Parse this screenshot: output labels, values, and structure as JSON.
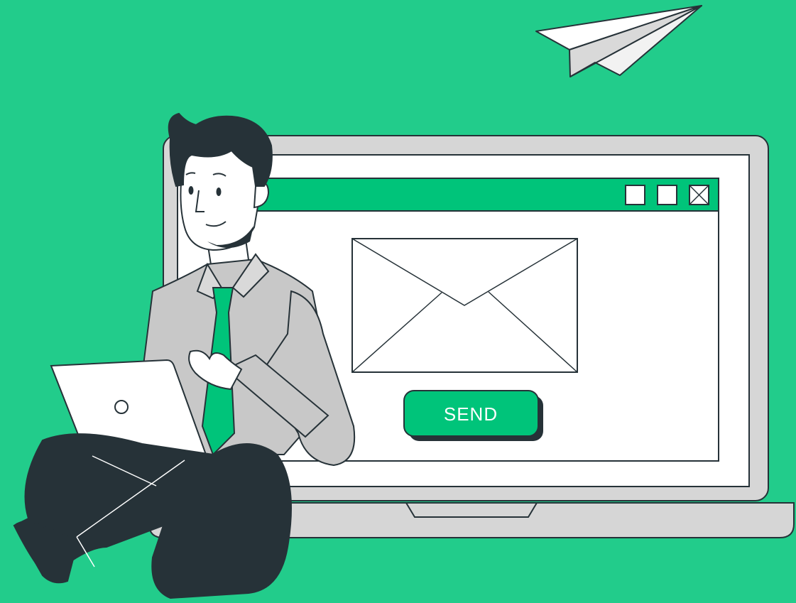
{
  "colors": {
    "background": "#22cc8b",
    "accent_green": "#00c47a",
    "outline": "#263238",
    "laptop_gray": "#d6d6d6",
    "screen_white": "#ffffff",
    "shirt_gray": "#c8c8c8",
    "pants_dark": "#263238",
    "skin": "#ffffff"
  },
  "window": {
    "controls": [
      "minimize-icon",
      "maximize-icon",
      "close-icon"
    ]
  },
  "main": {
    "envelope_icon": "envelope-icon",
    "send_label": "SEND"
  },
  "decor": {
    "paper_plane_icon": "paper-plane-icon",
    "person": "man-with-tie",
    "small_laptop_logo": "circle-logo-icon"
  }
}
